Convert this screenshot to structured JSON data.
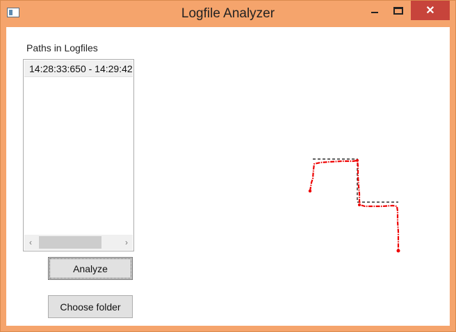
{
  "window": {
    "title": "Logfile Analyzer",
    "close_glyph": "✕"
  },
  "paths_panel": {
    "label": "Paths in Logfiles",
    "items": [
      "14:28:33:650 - 14:29:42"
    ],
    "scroll_left_glyph": "‹",
    "scroll_right_glyph": "›"
  },
  "buttons": {
    "analyze": "Analyze",
    "choose_folder": "Choose folder"
  },
  "plot": {
    "planned_path_color": "#000000",
    "actual_path_color": "#ee0000"
  },
  "icons": [
    "app-icon",
    "minimize-icon",
    "maximize-icon",
    "close-icon",
    "scroll-left-icon",
    "scroll-right-icon"
  ]
}
